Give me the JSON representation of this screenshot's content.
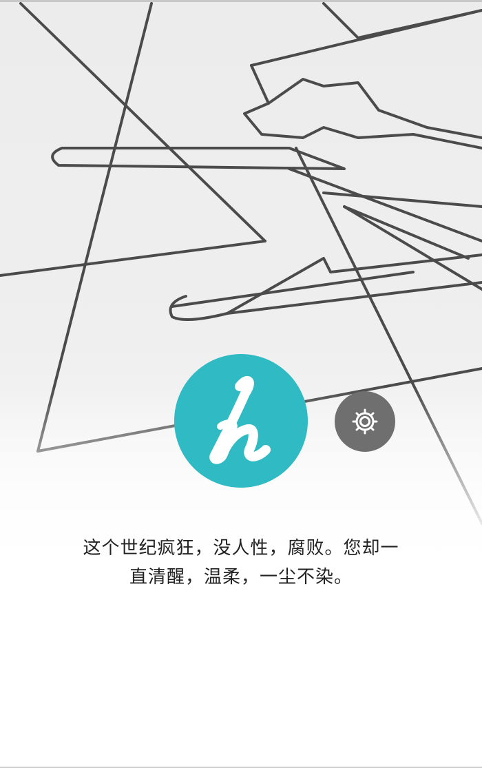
{
  "app": {
    "logo": {
      "icon": "handwritten-h-icon",
      "color": "#2fbac4"
    },
    "settings_button": {
      "icon": "gear-icon",
      "color": "#6f6f6f"
    }
  },
  "quote": {
    "line1": "这个世纪疯狂，没人性，腐败。您却一",
    "line2": "直清醒，温柔，一尘不染。"
  },
  "background": {
    "description_icon": "geometric-line-sketch",
    "line_color": "#3a3a3a"
  }
}
